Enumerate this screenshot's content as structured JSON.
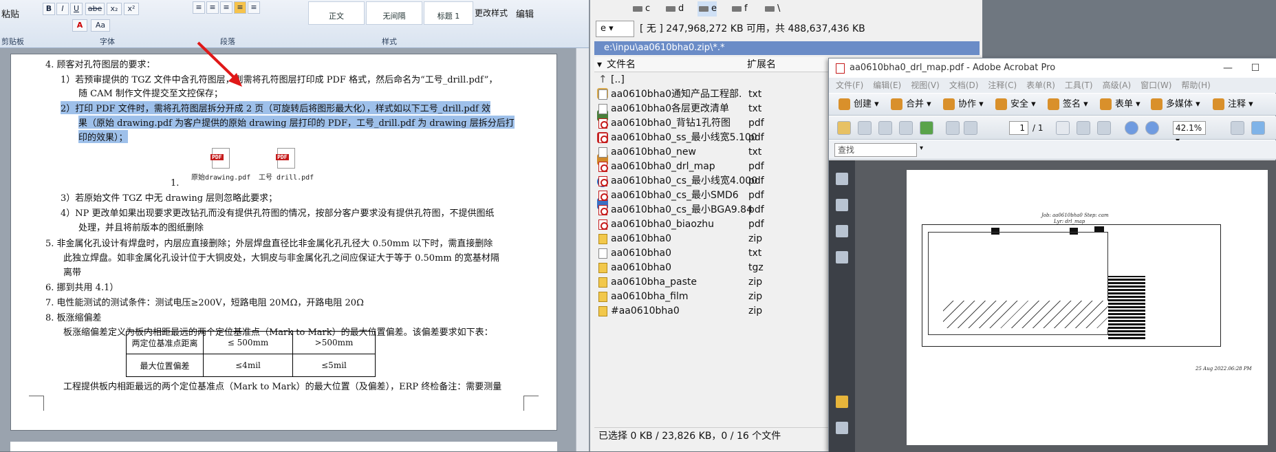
{
  "word": {
    "ribbon": {
      "paste": "粘贴",
      "clipboard": "剪贴板",
      "font_group": "字体",
      "paragraph_group": "段落",
      "styles_group": "样式",
      "style_normal": "正文",
      "style_nospacing": "无间隔",
      "style_heading1": "标题 1",
      "change_styles": "更改样式",
      "edit": "编辑",
      "bold": "B",
      "italic": "I",
      "underline": "U",
      "strike": "abe",
      "subscript": "x₂",
      "superscript": "x²",
      "font_color": "A",
      "font_size_btn": "Aa"
    },
    "doc": {
      "item4_title": "4.   顾客对孔符图层的要求：",
      "item4_1a": "1）若预审提供的 TGZ 文件中含孔符图层，则需将孔符图层打印成 PDF 格式，然后命名为“工号_drill.pdf”，",
      "item4_1b": "随 CAM 制作文件提交至文控保存；",
      "item4_2a": "2）打印 PDF 文件时，需将孔符图层拆分开成 2 页（可旋转后将图形最大化），样式如以下工号_drill.pdf 效",
      "item4_2b": "果（原始 drawing.pdf 为客户提供的原始 drawing 层打印的 PDF，工号_drill.pdf 为 drawing 层拆分后打",
      "item4_2c": "印的效果）；",
      "attach1": "原始drawing.pdf",
      "attach2": "工号 drill.pdf",
      "list_num": "1.",
      "item4_3": "3）若原始文件 TGZ 中无 drawing 层则忽略此要求；",
      "item4_4a": "4）NP 更改单如果出现要求更改钻孔而没有提供孔符图的情况，按部分客户要求没有提供孔符图，不提供图纸",
      "item4_4b": "处理，并且将前版本的图纸删除",
      "item5a": "5.   非金属化孔设计有焊盘时，内层应直接删除；外层焊盘直径比非金属化孔孔径大 0.50mm 以下时，需直接删除",
      "item5b": "此独立焊盘。如非金属化孔设计位于大铜皮处，大铜皮与非金属化孔之间应保证大于等于 0.50mm 的宽基材隔",
      "item5c": "离带",
      "item6": "6.   挪到共用 4.1）",
      "item7": "7.   电性能测试的测试条件：测试电压≥200V，短路电阻 20MΩ，开路电阻 20Ω",
      "item8": "8.   板涨缩偏差",
      "item8_desc": "板涨缩偏差定义为板内相距最远的两个定位基准点（Mark to Mark）的最大位置偏差。该偏差要求如下表：",
      "table": [
        [
          "两定位基准点距离",
          "≤ 500mm",
          ">500mm"
        ],
        [
          "最大位置偏差",
          "≤4mil",
          "≤5mil"
        ]
      ],
      "last_line": "工程提供板内相距最远的两个定位基准点（Mark to Mark）的最大位置（及偏差），ERP 终检备注：需要测量"
    }
  },
  "filemanager": {
    "drives": [
      "c",
      "d",
      "e",
      "f",
      "\\"
    ],
    "drive_select": "e",
    "space_info": "[ 无 ]  247,968,272 KB 可用，共 488,637,436 KB",
    "path": "e:\\inpu\\aa0610bha0.zip\\*.*",
    "col_name": "文件名",
    "col_ext": "扩展名",
    "files": [
      {
        "name": "[..]",
        "ext": "",
        "type": "up"
      },
      {
        "name": "aa0610bha0通知产品工程部.",
        "ext": "txt",
        "type": "txt"
      },
      {
        "name": "aa0610bha0各层更改清单",
        "ext": "txt",
        "type": "txt"
      },
      {
        "name": "aa0610bha0_背钻1孔符图",
        "ext": "pdf",
        "type": "pdf"
      },
      {
        "name": "aa0610bha0_ss_最小线宽5.100",
        "ext": "pdf",
        "type": "pdf"
      },
      {
        "name": "aa0610bha0_new",
        "ext": "txt",
        "type": "txt"
      },
      {
        "name": "aa0610bha0_drl_map",
        "ext": "pdf",
        "type": "pdf"
      },
      {
        "name": "aa0610bha0_cs_最小线宽4.000",
        "ext": "pdf",
        "type": "pdf"
      },
      {
        "name": "aa0610bha0_cs_最小SMD6",
        "ext": "pdf",
        "type": "pdf"
      },
      {
        "name": "aa0610bha0_cs_最小BGA9.84",
        "ext": "pdf",
        "type": "pdf"
      },
      {
        "name": "aa0610bha0_biaozhu",
        "ext": "pdf",
        "type": "pdf"
      },
      {
        "name": "aa0610bha0",
        "ext": "zip",
        "type": "zip"
      },
      {
        "name": "aa0610bha0",
        "ext": "txt",
        "type": "txt"
      },
      {
        "name": "aa0610bha0",
        "ext": "tgz",
        "type": "zip"
      },
      {
        "name": "aa0610bha_paste",
        "ext": "zip",
        "type": "zip"
      },
      {
        "name": "aa0610bha_film",
        "ext": "zip",
        "type": "zip"
      },
      {
        "name": "#aa0610bha0",
        "ext": "zip",
        "type": "zip"
      }
    ],
    "status": "已选择 0 KB / 23,826 KB，0 / 16 个文件"
  },
  "acrobat": {
    "title": "aa0610bha0_drl_map.pdf - Adobe Acrobat Pro",
    "menu": [
      "文件(F)",
      "编辑(E)",
      "视图(V)",
      "文档(D)",
      "注释(C)",
      "表单(R)",
      "工具(T)",
      "高级(A)",
      "窗口(W)",
      "帮助(H)"
    ],
    "tools": [
      "创建",
      "合并",
      "协作",
      "安全",
      "签名",
      "表单",
      "多媒体",
      "注释"
    ],
    "page_num": "1",
    "page_total": "/ 1",
    "zoom": "42.1%",
    "find_placeholder": "查找",
    "pdf_header1": "Job: aa0610bha0  Step: cam",
    "pdf_header2": "Lyr: drl_map",
    "pdf_date": "25 Aug 2022.06:28 PM"
  },
  "colors": {
    "selection": "#9ec0ea",
    "path_bar": "#6b8cc7",
    "arrow": "#e01818",
    "acrobat_viewer_bg": "#595c61"
  }
}
